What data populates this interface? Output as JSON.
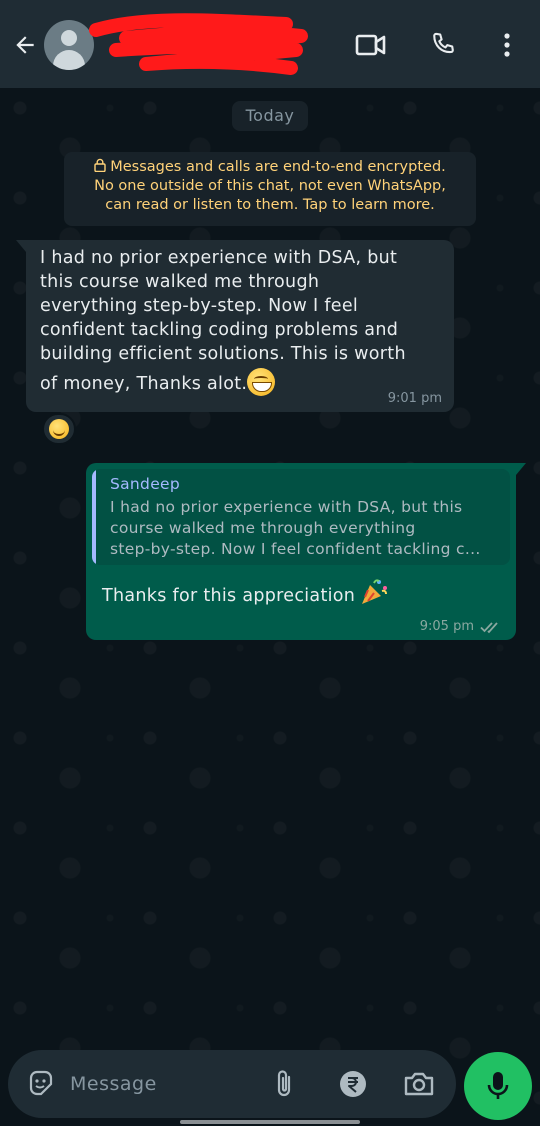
{
  "header": {
    "contact_name": "",
    "back_icon": "arrow-left-icon",
    "icons": [
      "video-call-icon",
      "phone-icon",
      "more-vert-icon"
    ]
  },
  "chat": {
    "date_chip": "Today",
    "encryption_notice": {
      "line1": "Messages and calls are end-to-end encrypted.",
      "line2": "No one outside of this chat, not even WhatsApp,",
      "line3": "can read or listen to them. Tap to learn more."
    },
    "messages": [
      {
        "direction": "incoming",
        "lines": [
          "I had no prior experience with DSA, but",
          "this course walked me through",
          "everything step-by-step. Now I feel",
          "confident tackling coding problems and",
          "building efficient solutions. This is worth",
          "of money, Thanks alot."
        ],
        "emoji": "grinning-face",
        "time": "9:01 pm",
        "reaction": "smiling-face-with-sweat"
      },
      {
        "direction": "outgoing",
        "quoted": {
          "author": "Sandeep",
          "lines": [
            "I had no prior experience with DSA, but this",
            "course walked me through everything",
            "step-by-step. Now I feel confident tackling c..."
          ]
        },
        "text": "Thanks for this appreciation",
        "emoji": "party-popper",
        "time": "9:05 pm",
        "status": "read"
      }
    ]
  },
  "composer": {
    "placeholder": "Message",
    "value": "",
    "icons": [
      "emoji-sticker-icon",
      "attach-icon",
      "rupee-payment-icon",
      "camera-icon",
      "mic-icon"
    ]
  },
  "colors": {
    "header_bg": "#1f2c34",
    "chat_bg": "#0b141a",
    "incoming_bubble": "#202c33",
    "outgoing_bubble": "#005c4b",
    "quote_accent": "#a5b9ff",
    "encryption_text": "#ffd279",
    "mic_button": "#21c063"
  }
}
